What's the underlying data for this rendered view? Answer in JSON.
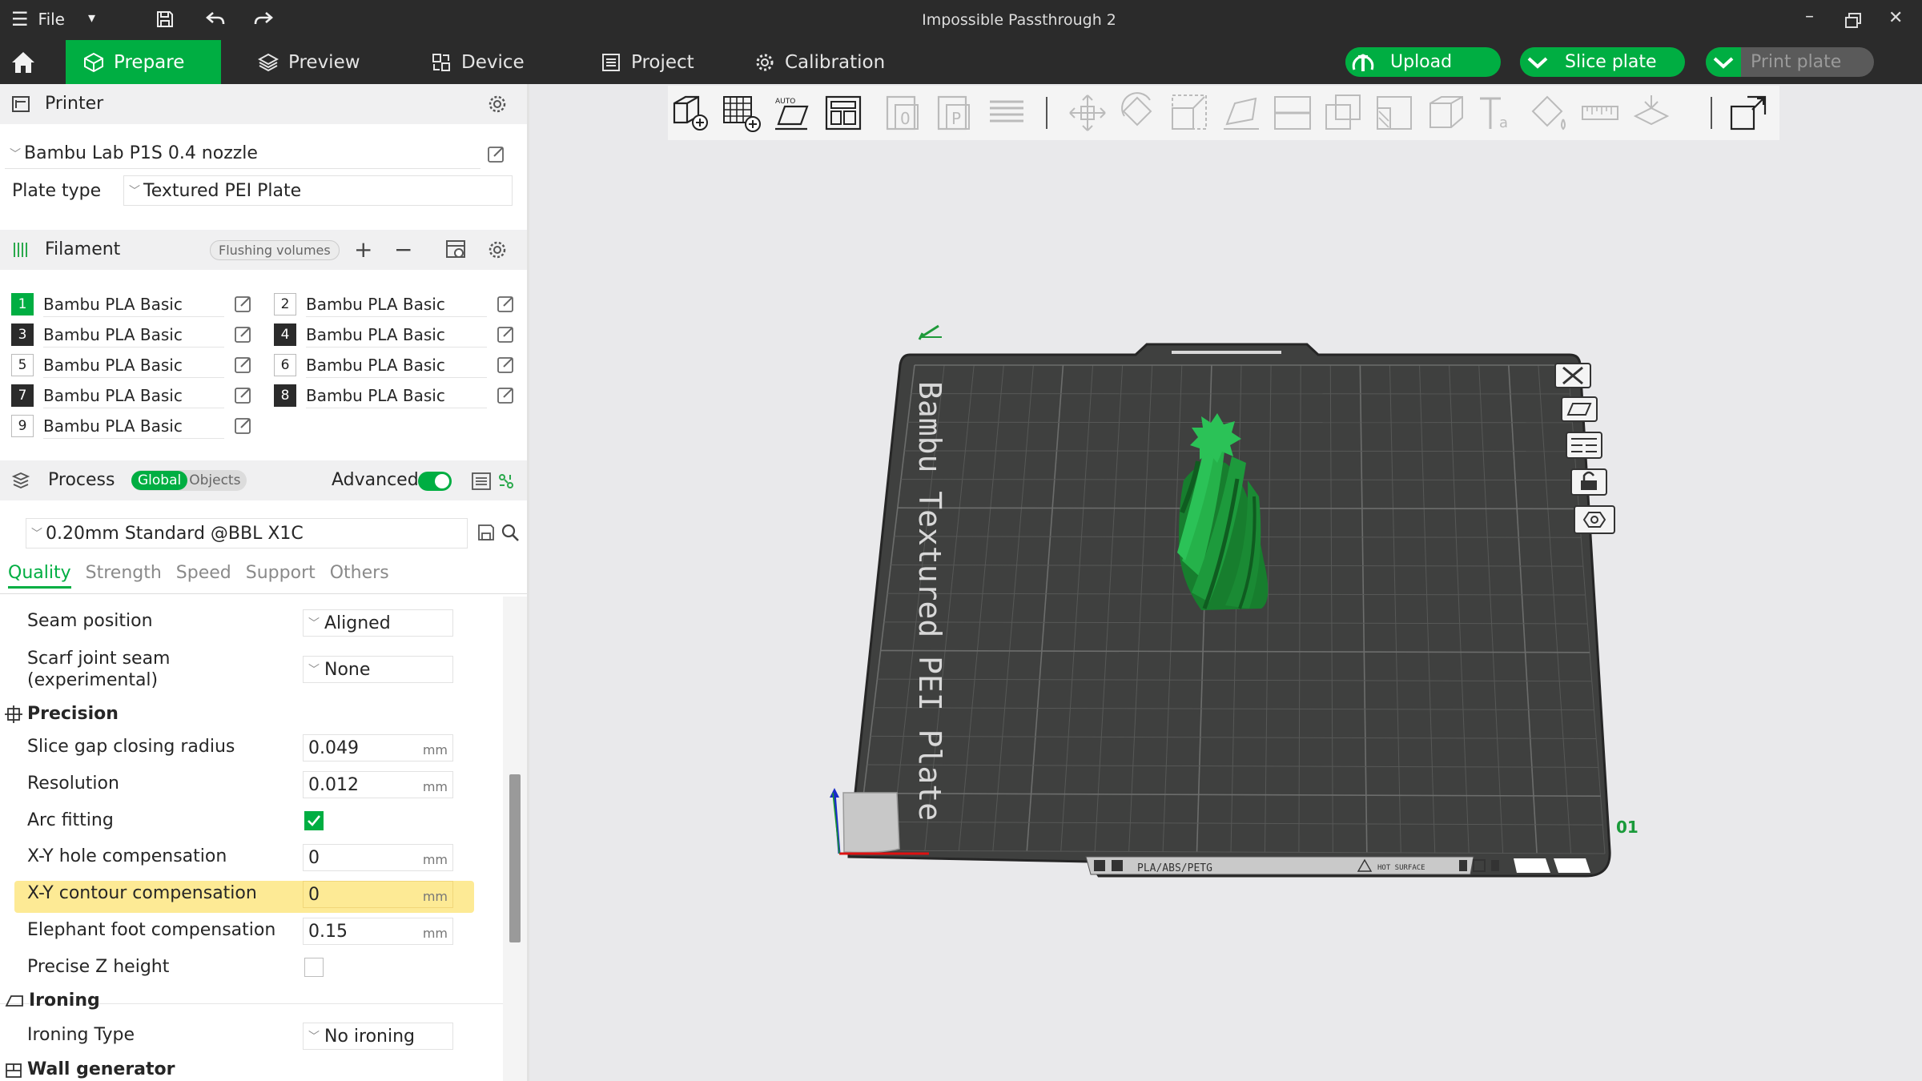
{
  "window": {
    "title": "Impossible Passthrough 2",
    "file_menu_label": "File"
  },
  "nav": {
    "tabs": [
      {
        "label": "Prepare",
        "active": true
      },
      {
        "label": "Preview"
      },
      {
        "label": "Device"
      },
      {
        "label": "Project"
      },
      {
        "label": "Calibration"
      }
    ],
    "upload_label": "Upload",
    "slice_label": "Slice plate",
    "print_label": "Print plate"
  },
  "printer": {
    "section_label": "Printer",
    "selected_printer": "Bambu Lab P1S 0.4 nozzle",
    "plate_type_label": "Plate type",
    "plate_type_value": "Textured PEI Plate"
  },
  "filament": {
    "section_label": "Filament",
    "flushing_label": "Flushing volumes",
    "slots": [
      {
        "num": "1",
        "name": "Bambu PLA Basic",
        "style": "green"
      },
      {
        "num": "2",
        "name": "Bambu PLA Basic",
        "style": "light"
      },
      {
        "num": "3",
        "name": "Bambu PLA Basic",
        "style": "dark"
      },
      {
        "num": "4",
        "name": "Bambu PLA Basic",
        "style": "dark"
      },
      {
        "num": "5",
        "name": "Bambu PLA Basic",
        "style": "light"
      },
      {
        "num": "6",
        "name": "Bambu PLA Basic",
        "style": "light"
      },
      {
        "num": "7",
        "name": "Bambu PLA Basic",
        "style": "dark"
      },
      {
        "num": "8",
        "name": "Bambu PLA Basic",
        "style": "dark"
      },
      {
        "num": "9",
        "name": "Bambu PLA Basic",
        "style": "light"
      }
    ]
  },
  "process": {
    "section_label": "Process",
    "global_label": "Global",
    "objects_label": "Objects",
    "advanced_label": "Advanced",
    "advanced_on": true,
    "preset": "0.20mm Standard @BBL X1C",
    "tabs": [
      "Quality",
      "Strength",
      "Speed",
      "Support",
      "Others"
    ],
    "active_tab": "Quality",
    "seam_position_label": "Seam position",
    "seam_position_value": "Aligned",
    "scarf_label_1": "Scarf joint seam",
    "scarf_label_2": "(experimental)",
    "scarf_value": "None",
    "precision_header": "Precision",
    "slice_gap_label": "Slice gap closing radius",
    "slice_gap_value": "0.049",
    "resolution_label": "Resolution",
    "resolution_value": "0.012",
    "arc_fitting_label": "Arc fitting",
    "arc_fitting_checked": true,
    "xy_hole_label": "X-Y hole compensation",
    "xy_hole_value": "0",
    "xy_contour_label": "X-Y contour compensation",
    "xy_contour_value": "0",
    "elephant_label": "Elephant foot compensation",
    "elephant_value": "0.15",
    "precise_z_label": "Precise Z height",
    "precise_z_checked": false,
    "ironing_header": "Ironing",
    "ironing_type_label": "Ironing Type",
    "ironing_type_value": "No ironing",
    "wall_gen_header": "Wall generator",
    "unit_mm": "mm"
  },
  "plate": {
    "bed_label": "Bambu Textured PEI Plate",
    "plate_number": "01",
    "material_text": "PLA/ABS/PETG",
    "hot_surface_text": "HOT SURFACE",
    "model_color": "#1f9a3a",
    "bed_color": "#3f403f"
  }
}
